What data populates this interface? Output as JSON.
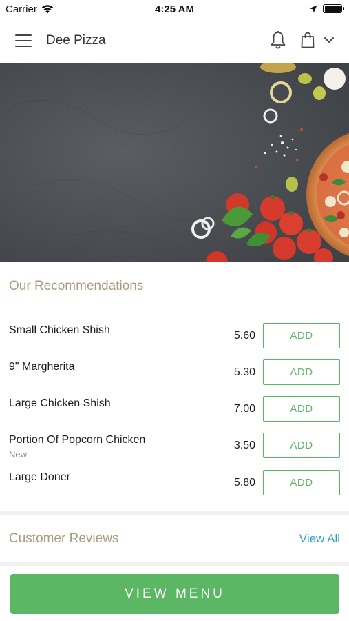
{
  "status_bar": {
    "carrier": "Carrier",
    "time": "4:25 AM"
  },
  "header": {
    "title": "Dee Pizza",
    "icons": [
      "hamburger-menu-icon",
      "bell-icon",
      "shopping-bag-icon",
      "chevron-down-icon"
    ]
  },
  "hero": {
    "image": "pizza-ingredients-banner"
  },
  "recommendations": {
    "title": "Our Recommendations",
    "add_label": "ADD",
    "items": [
      {
        "name": "Small Chicken Shish",
        "price": "5.60",
        "tag": ""
      },
      {
        "name": "9\" Margherita",
        "price": "5.30",
        "tag": ""
      },
      {
        "name": "Large Chicken Shish",
        "price": "7.00",
        "tag": ""
      },
      {
        "name": "Portion Of Popcorn Chicken",
        "price": "3.50",
        "tag": "New"
      },
      {
        "name": "Large Doner",
        "price": "5.80",
        "tag": ""
      }
    ]
  },
  "reviews": {
    "title": "Customer Reviews",
    "view_all": "View All"
  },
  "bottom": {
    "view_menu": "VIEW MENU"
  },
  "colors": {
    "accent_green": "#5cb764",
    "section_title": "#a89c7e",
    "link_blue": "#2a9fd6"
  }
}
